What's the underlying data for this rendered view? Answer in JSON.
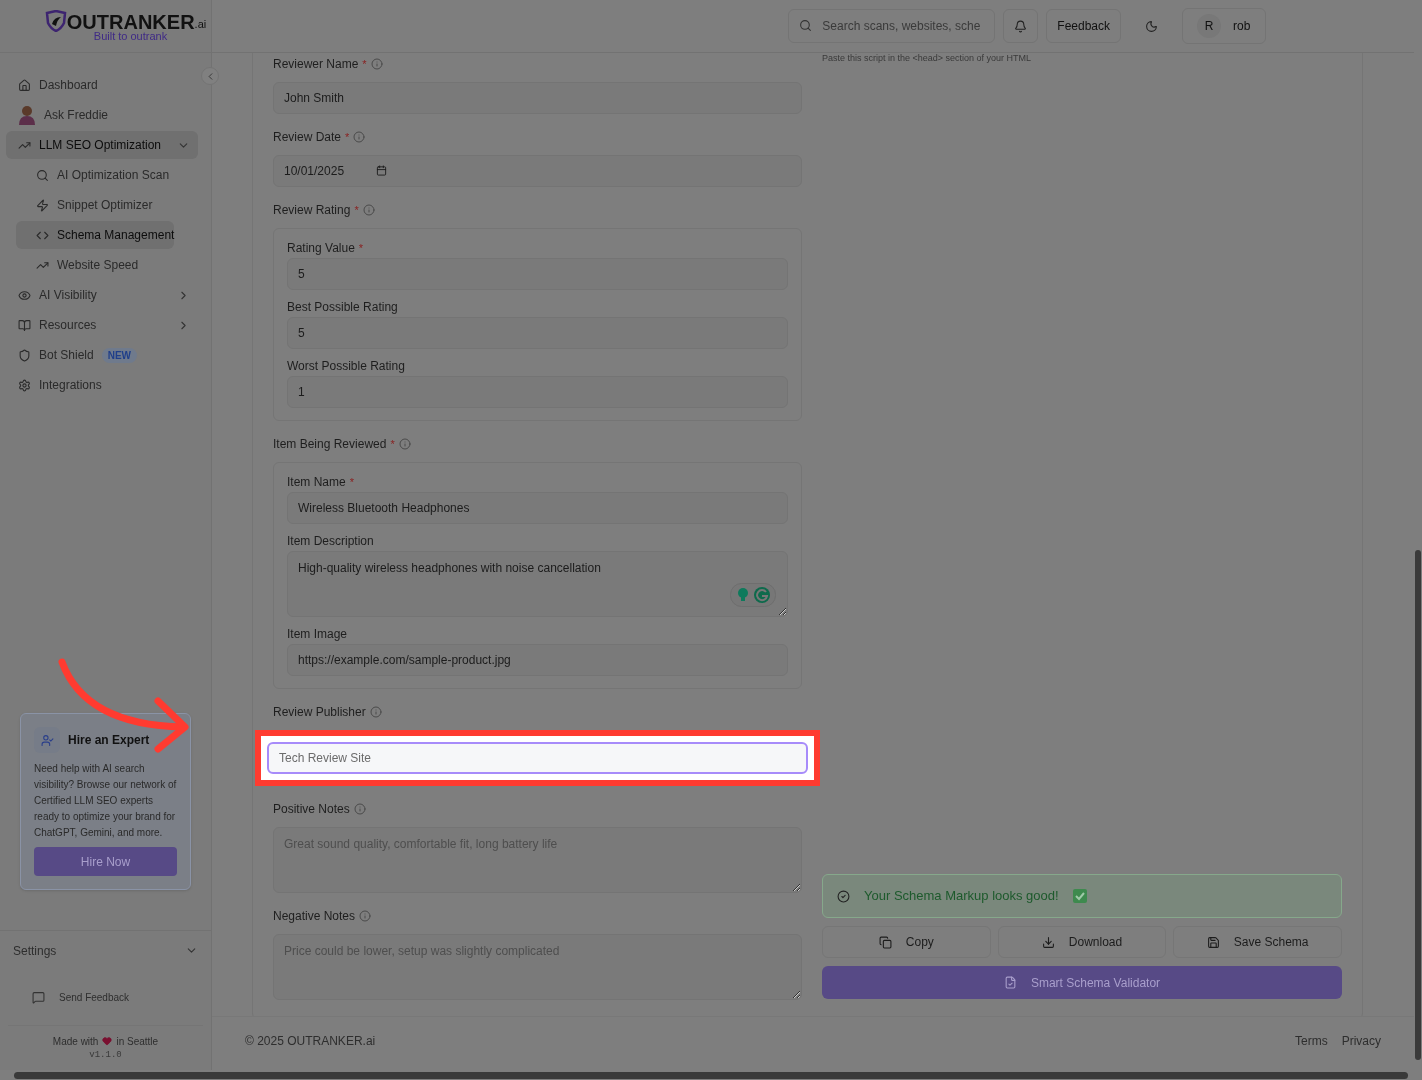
{
  "header": {
    "logo": {
      "name": "OUTRANKER",
      "suffix": ".ai",
      "tagline": "Built to outrank"
    },
    "search": {
      "placeholder": "Search scans, websites, sche"
    },
    "feedback": "Feedback",
    "user": {
      "initial": "R",
      "name": "rob"
    }
  },
  "sidebar": {
    "items": [
      {
        "kind": "home",
        "label": "Dashboard",
        "selected": false
      },
      {
        "kind": "avatar",
        "label": "Ask Freddie",
        "selected": false
      },
      {
        "kind": "trend",
        "label": "LLM SEO Optimization",
        "selected": true,
        "expanded": true,
        "children": [
          {
            "kind": "search",
            "label": "AI Optimization Scan",
            "selected": false
          },
          {
            "kind": "zap",
            "label": "Snippet Optimizer",
            "selected": false
          },
          {
            "kind": "code",
            "label": "Schema Management",
            "selected": true
          },
          {
            "kind": "trend",
            "label": "Website Speed",
            "selected": false
          }
        ]
      },
      {
        "kind": "eye",
        "label": "AI Visibility",
        "selected": false,
        "expanded": false
      },
      {
        "kind": "book",
        "label": "Resources",
        "selected": false,
        "expanded": false
      },
      {
        "kind": "shield",
        "label": "Bot Shield",
        "selected": false,
        "badge": "NEW"
      },
      {
        "kind": "gear",
        "label": "Integrations",
        "selected": false
      }
    ],
    "hire_card": {
      "title": "Hire an Expert",
      "text": "Need help with AI search visibility? Browse our network of Certified LLM SEO experts ready to optimize your brand for ChatGPT, Gemini, and more.",
      "button": "Hire Now"
    },
    "settings": {
      "label": "Settings",
      "expanded": false
    },
    "send_feedback": "Send Feedback",
    "made_with": "Made with",
    "made_in": "in Seattle",
    "version": "v1.1.0"
  },
  "form": {
    "required_mark": "*",
    "fields": [
      {
        "kind": "input",
        "label": "Reviewer Name",
        "required": true,
        "info": true,
        "value": "John Smith",
        "highlighted": false
      },
      {
        "kind": "date",
        "label": "Review Date",
        "required": true,
        "info": true,
        "value": "10/01/2025"
      },
      {
        "kind": "group",
        "label": "Review Rating",
        "required": true,
        "info": true,
        "fields": [
          {
            "kind": "input",
            "label": "Rating Value",
            "required": true,
            "value": "5",
            "highlighted": false
          },
          {
            "kind": "input",
            "label": "Best Possible Rating",
            "required": false,
            "value": "5",
            "highlighted": false
          },
          {
            "kind": "input",
            "label": "Worst Possible Rating",
            "required": false,
            "value": "1",
            "highlighted": false
          }
        ]
      },
      {
        "kind": "group",
        "label": "Item Being Reviewed",
        "required": true,
        "info": true,
        "fields": [
          {
            "kind": "input",
            "label": "Item Name",
            "required": true,
            "value": "Wireless Bluetooth Headphones",
            "highlighted": false
          },
          {
            "kind": "textarea",
            "label": "Item Description",
            "required": false,
            "value": "High-quality wireless headphones with noise cancellation",
            "grammar": true
          },
          {
            "kind": "input",
            "label": "Item Image",
            "required": false,
            "value": "https://example.com/sample-product.jpg",
            "highlighted": false
          }
        ]
      },
      {
        "kind": "input",
        "label": "Review Publisher",
        "required": false,
        "info": true,
        "placeholder": "Tech Review Site",
        "highlighted": true
      },
      {
        "kind": "textarea",
        "label": "Positive Notes",
        "required": false,
        "info": true,
        "placeholder": "Great sound quality, comfortable fit, long battery life"
      },
      {
        "kind": "textarea",
        "label": "Negative Notes",
        "required": false,
        "info": true,
        "placeholder": "Price could be lower, setup was slightly complicated"
      }
    ]
  },
  "output": {
    "hint": "Paste this script in the <head> section of your HTML",
    "status": "Your Schema Markup looks good!",
    "actions": [
      {
        "kind": "copy",
        "label": "Copy"
      },
      {
        "kind": "download",
        "label": "Download"
      },
      {
        "kind": "save",
        "label": "Save Schema"
      }
    ],
    "validator": "Smart Schema Validator"
  },
  "footer": {
    "copyright": "© 2025 OUTRANKER.ai",
    "links": [
      "Terms",
      "Privacy"
    ]
  }
}
